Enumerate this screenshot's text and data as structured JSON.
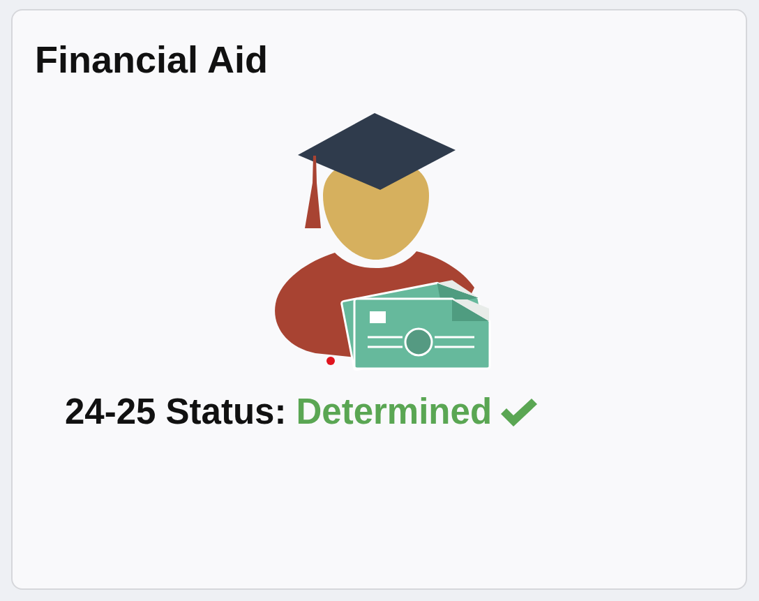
{
  "card": {
    "title": "Financial Aid",
    "status": {
      "label": "24-25 Status:",
      "value": "Determined",
      "complete": true
    }
  }
}
